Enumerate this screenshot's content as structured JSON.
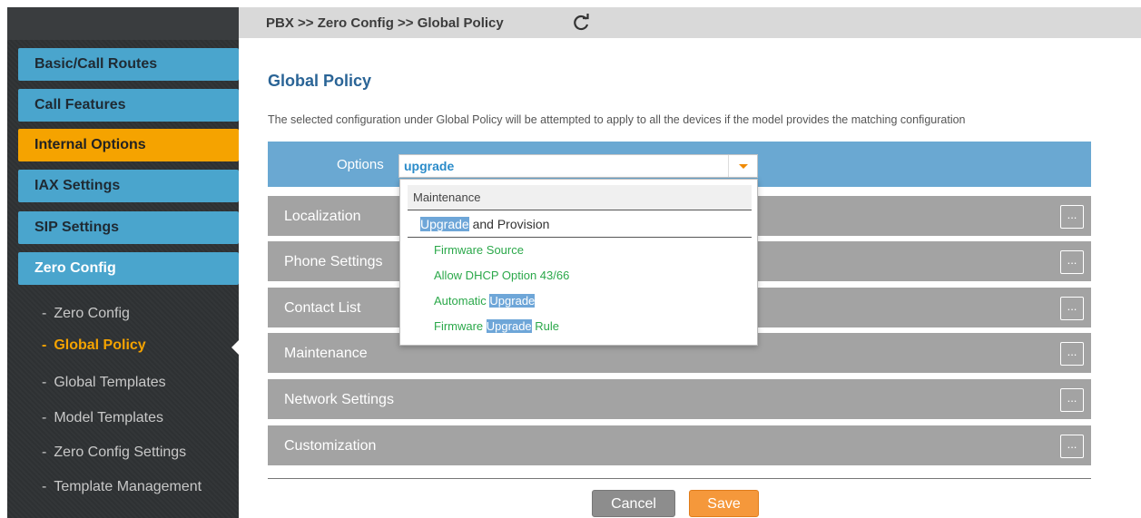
{
  "breadcrumb": "PBX >> Zero Config >> Global Policy",
  "sidebar": {
    "buttons": [
      {
        "label": "Basic/Call Routes"
      },
      {
        "label": "Call Features"
      },
      {
        "label": "Internal Options"
      },
      {
        "label": "IAX Settings"
      },
      {
        "label": "SIP Settings"
      },
      {
        "label": "Zero Config"
      }
    ],
    "sub_items": [
      {
        "dash": "-",
        "label": "Zero Config"
      },
      {
        "dash": "-",
        "label": "Global Policy"
      },
      {
        "dash": "-",
        "label": "Global Templates"
      },
      {
        "dash": "-",
        "label": "Model Templates"
      },
      {
        "dash": "-",
        "label": "Zero Config Settings"
      },
      {
        "dash": "-",
        "label": "Template Management"
      }
    ]
  },
  "main": {
    "title": "Global Policy",
    "description": "The selected configuration under Global Policy will be attempted to apply to all the devices if the model provides the matching configuration",
    "options_label": "Options",
    "options_value": "upgrade",
    "sections": [
      {
        "label": "Localization",
        "more": "..."
      },
      {
        "label": "Phone Settings",
        "more": "..."
      },
      {
        "label": "Contact List",
        "more": "..."
      },
      {
        "label": "Maintenance",
        "more": "..."
      },
      {
        "label": "Network Settings",
        "more": "..."
      },
      {
        "label": "Customization",
        "more": "..."
      }
    ],
    "cancel_label": "Cancel",
    "save_label": "Save"
  },
  "dropdown": {
    "group1": "Maintenance",
    "group2_highlight": "Upgrade",
    "group2_rest": " and Provision",
    "items": [
      {
        "pre": "Firmware Source",
        "hl": "",
        "post": ""
      },
      {
        "pre": "Allow DHCP Option 43/66",
        "hl": "",
        "post": ""
      },
      {
        "pre": "Automatic ",
        "hl": "Upgrade",
        "post": ""
      },
      {
        "pre": "Firmware ",
        "hl": "Upgrade",
        "post": " Rule"
      }
    ]
  },
  "colors": {
    "accent_blue": "#4aa5cd",
    "active_orange": "#f5a300",
    "save_orange": "#f5983b",
    "options_bar": "#6aa8d2",
    "section_gray": "#a3a3a3"
  }
}
